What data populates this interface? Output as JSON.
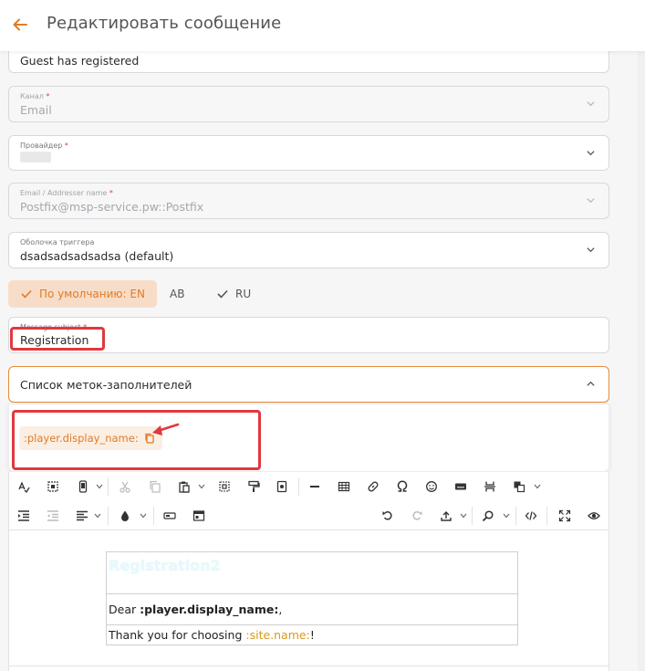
{
  "header": {
    "title": "Редактировать сообщение"
  },
  "fields": {
    "name": {
      "value": "Guest has registered"
    },
    "channel": {
      "label": "Канал",
      "required_mark": "*",
      "value": "Email"
    },
    "provider": {
      "label": "Провайдер",
      "required_mark": "*",
      "value": ""
    },
    "email_addresser": {
      "label": "Email / Addresser name",
      "required_mark": "*",
      "value": "Postfix@msp-service.pw::Postfix"
    },
    "trigger_shell": {
      "label": "Оболочка триггера",
      "value": "dsadsadsadsadsa (default)"
    }
  },
  "tabs": [
    {
      "label": "По умолчанию: EN",
      "active": true,
      "checked": true
    },
    {
      "label": "AB",
      "active": false,
      "checked": false
    },
    {
      "label": "RU",
      "active": false,
      "checked": true
    }
  ],
  "subject": {
    "label": "Message subject",
    "required_mark": "*",
    "value": "Registration"
  },
  "placeholders": {
    "title": "Список меток-заполнителей",
    "items": [
      ":player.display_name:"
    ]
  },
  "editor": {
    "title_text": "Registration2",
    "greeting_prefix": "Dear ",
    "greeting_tag": ":player.display_name:",
    "greeting_suffix": ",",
    "thanks_prefix": "Thank you for choosing ",
    "thanks_tag": ":site.name:",
    "thanks_suffix": "!"
  },
  "colors": {
    "accent": "#e07c26",
    "highlight_box": "#e0393f",
    "tag": "#d99a1a"
  }
}
